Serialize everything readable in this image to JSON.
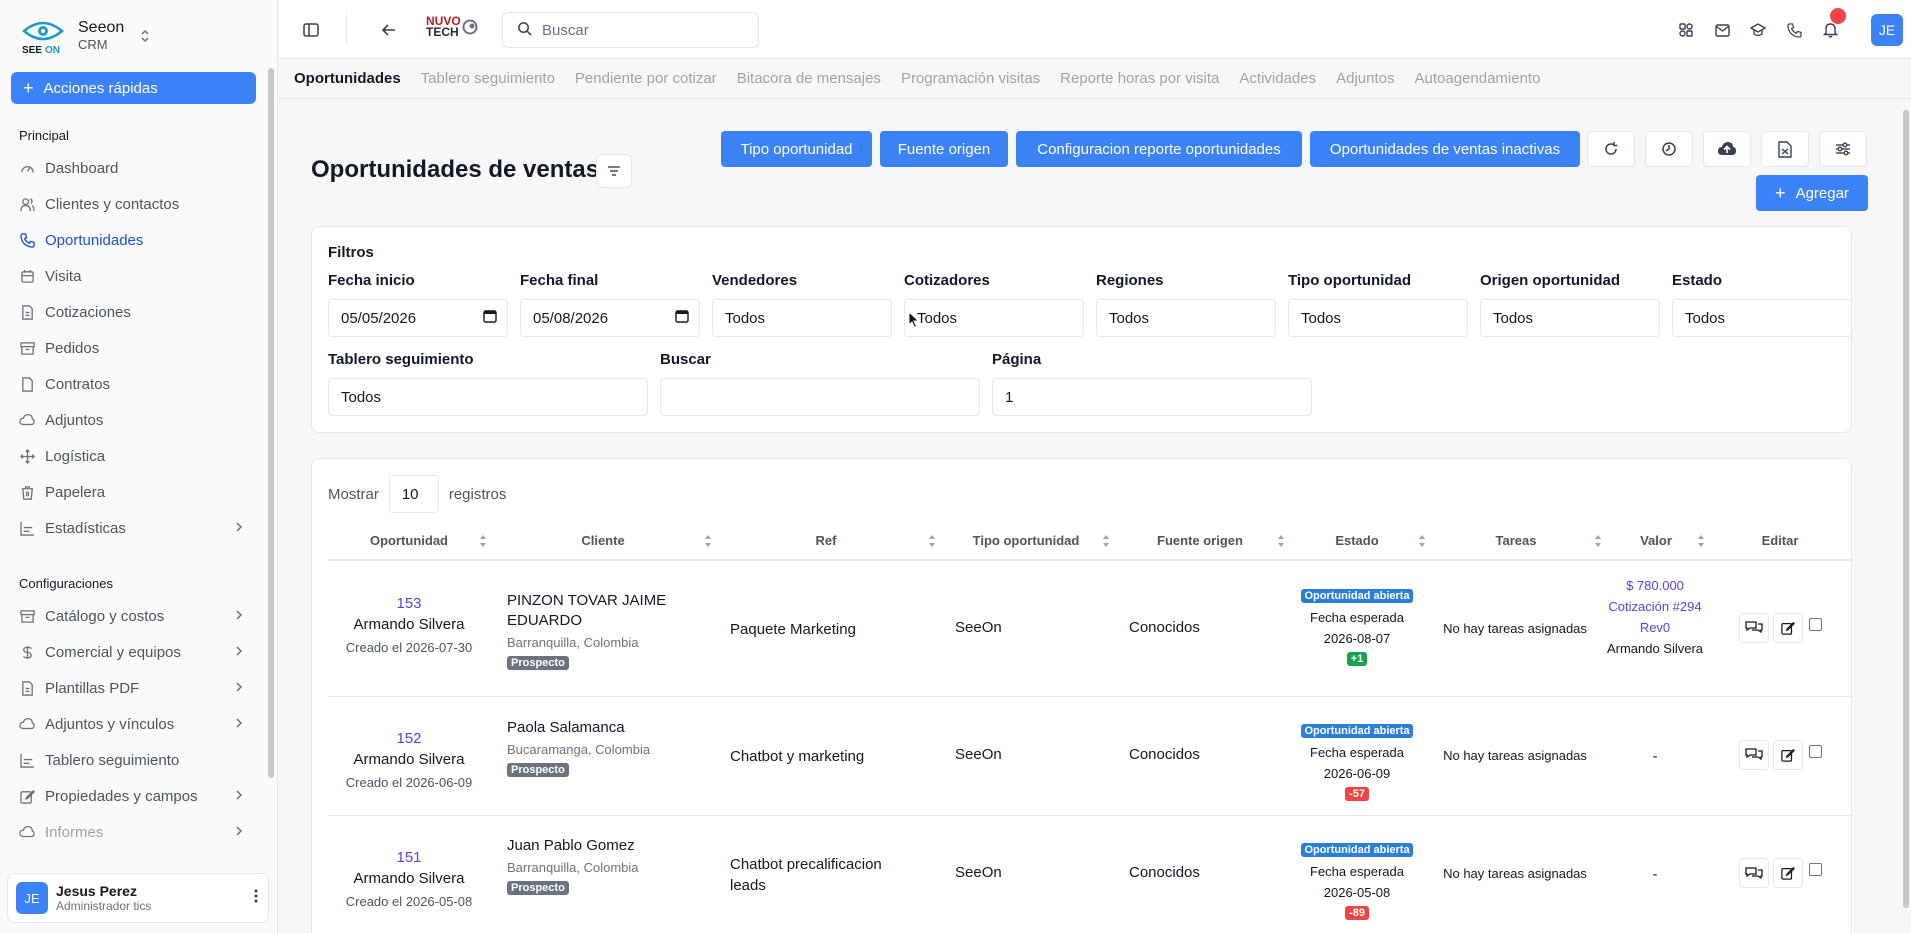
{
  "brand": {
    "name": "Seeon",
    "subtitle": "CRM"
  },
  "sidebar": {
    "quick_actions": "Acciones rápidas",
    "section_principal": "Principal",
    "principal": [
      {
        "label": "Dashboard",
        "icon": "gauge-icon",
        "active": false,
        "chevron": false
      },
      {
        "label": "Clientes y contactos",
        "icon": "users-icon",
        "active": false,
        "chevron": false
      },
      {
        "label": "Oportunidades",
        "icon": "phone-icon",
        "active": true,
        "chevron": false
      },
      {
        "label": "Visita",
        "icon": "calendar-icon",
        "active": false,
        "chevron": false
      },
      {
        "label": "Cotizaciones",
        "icon": "document-icon",
        "active": false,
        "chevron": false
      },
      {
        "label": "Pedidos",
        "icon": "archive-icon",
        "active": false,
        "chevron": false
      },
      {
        "label": "Contratos",
        "icon": "file-icon",
        "active": false,
        "chevron": false
      },
      {
        "label": "Adjuntos",
        "icon": "cloud-icon",
        "active": false,
        "chevron": false
      },
      {
        "label": "Logística",
        "icon": "move-icon",
        "active": false,
        "chevron": false
      },
      {
        "label": "Papelera",
        "icon": "trash-icon",
        "active": false,
        "chevron": false
      },
      {
        "label": "Estadísticas",
        "icon": "bar-chart-icon",
        "active": false,
        "chevron": true
      }
    ],
    "section_config": "Configuraciones",
    "config": [
      {
        "label": "Catálogo y costos",
        "icon": "archive-icon",
        "chevron": true,
        "muted": false
      },
      {
        "label": "Comercial y equipos",
        "icon": "dollar-icon",
        "chevron": true,
        "muted": false
      },
      {
        "label": "Plantillas PDF",
        "icon": "document-icon",
        "chevron": true,
        "muted": false
      },
      {
        "label": "Adjuntos y vínculos",
        "icon": "cloud-icon",
        "chevron": true,
        "muted": false
      },
      {
        "label": "Tablero seguimiento",
        "icon": "bar-chart-icon",
        "chevron": false,
        "muted": false
      },
      {
        "label": "Propiedades y campos",
        "icon": "edit-icon",
        "chevron": true,
        "muted": false
      },
      {
        "label": "Informes",
        "icon": "cloud-icon",
        "chevron": true,
        "muted": true
      }
    ],
    "user": {
      "initials": "JE",
      "name": "Jesus Perez",
      "role": "Administrador tics"
    }
  },
  "header": {
    "partner_logo_line1": "NUVO",
    "partner_logo_line2": "TECH",
    "search_placeholder": "Buscar",
    "avatar_initials": "JE"
  },
  "tabs": [
    {
      "label": "Oportunidades",
      "active": true
    },
    {
      "label": "Tablero seguimiento",
      "active": false
    },
    {
      "label": "Pendiente por cotizar",
      "active": false
    },
    {
      "label": "Bitacora de mensajes",
      "active": false
    },
    {
      "label": "Programación visitas",
      "active": false
    },
    {
      "label": "Reporte horas por visita",
      "active": false
    },
    {
      "label": "Actividades",
      "active": false
    },
    {
      "label": "Adjuntos",
      "active": false
    },
    {
      "label": "Autoagendamiento",
      "active": false
    }
  ],
  "page": {
    "title": "Oportunidades de ventas",
    "buttons": {
      "tipo": "Tipo oportunidad",
      "fuente": "Fuente origen",
      "config": "Configuracion reporte oportunidades",
      "inactivas": "Oportunidades de ventas inactivas",
      "agregar": "Agregar"
    }
  },
  "filters": {
    "title": "Filtros",
    "fecha_inicio": {
      "label": "Fecha inicio",
      "value": "05/05/2026"
    },
    "fecha_final": {
      "label": "Fecha final",
      "value": "05/08/2026"
    },
    "vendedores": {
      "label": "Vendedores",
      "value": "Todos"
    },
    "cotizadores": {
      "label": "Cotizadores",
      "value": "Todos"
    },
    "regiones": {
      "label": "Regiones",
      "value": "Todos"
    },
    "tipo": {
      "label": "Tipo oportunidad",
      "value": "Todos"
    },
    "origen": {
      "label": "Origen oportunidad",
      "value": "Todos"
    },
    "estado": {
      "label": "Estado",
      "value": "Todos"
    },
    "tablero": {
      "label": "Tablero seguimiento",
      "value": "Todos"
    },
    "buscar": {
      "label": "Buscar",
      "value": ""
    },
    "pagina": {
      "label": "Página",
      "value": "1"
    }
  },
  "table": {
    "show_label": "Mostrar",
    "show_count": "10",
    "records_label": "registros",
    "columns": [
      "Oportunidad",
      "Cliente",
      "Ref",
      "Tipo oportunidad",
      "Fuente origen",
      "Estado",
      "Tareas",
      "Valor",
      "Editar"
    ],
    "rows": [
      {
        "id": "153",
        "seller": "Armando Silvera",
        "created": "Creado el 2026-07-30",
        "client": "PINZON TOVAR JAIME EDUARDO",
        "location": "Barranquilla, Colombia",
        "client_badge": "Prospecto",
        "ref": "Paquete Marketing",
        "tipo": "SeeOn",
        "fuente": "Conocidos",
        "estado_badge": "Oportunidad abierta",
        "fecha_label": "Fecha esperada",
        "fecha": "2026-08-07",
        "days": "+1",
        "days_color": "#16a34a",
        "tareas": "No hay tareas asignadas",
        "valor_amount": "$ 780.000",
        "valor_quote": "Cotización #294 Rev0",
        "valor_seller": "Armando Silvera",
        "valor": ""
      },
      {
        "id": "152",
        "seller": "Armando Silvera",
        "created": "Creado el 2026-06-09",
        "client": "Paola Salamanca",
        "location": "Bucaramanga, Colombia",
        "client_badge": "Prospecto",
        "ref": "Chatbot y marketing",
        "tipo": "SeeOn",
        "fuente": "Conocidos",
        "estado_badge": "Oportunidad abierta",
        "fecha_label": "Fecha esperada",
        "fecha": "2026-06-09",
        "days": "-57",
        "days_color": "#ef4444",
        "tareas": "No hay tareas asignadas",
        "valor": "-"
      },
      {
        "id": "151",
        "seller": "Armando Silvera",
        "created": "Creado el 2026-05-08",
        "client": "Juan Pablo Gomez",
        "location": "Barranquilla, Colombia",
        "client_badge": "Prospecto",
        "ref": "Chatbot precalificacion leads",
        "tipo": "SeeOn",
        "fuente": "Conocidos",
        "estado_badge": "Oportunidad abierta",
        "fecha_label": "Fecha esperada",
        "fecha": "2026-05-08",
        "days": "-89",
        "days_color": "#ef4444",
        "tareas": "No hay tareas asignadas",
        "valor": "-"
      }
    ]
  }
}
